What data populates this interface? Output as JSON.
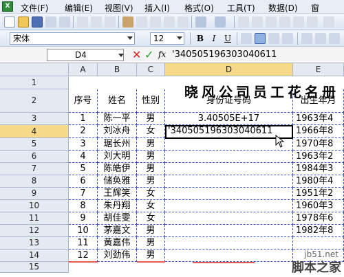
{
  "menu": [
    "文件(F)",
    "编辑(E)",
    "视图(V)",
    "插入(I)",
    "格式(O)",
    "工具(T)",
    "数据(D)",
    "窗"
  ],
  "toolbar": {
    "font": "宋体",
    "size": "12"
  },
  "formula_bar": {
    "name_box": "D4",
    "formula": "'340505196303040611",
    "fx": "fx"
  },
  "columns": [
    "A",
    "B",
    "C",
    "D",
    "E"
  ],
  "rows": [
    "1",
    "2",
    "3",
    "4",
    "5",
    "6",
    "7",
    "8",
    "9",
    "10",
    "11",
    "12",
    "13",
    "14",
    "15"
  ],
  "title": "晓风公司员工花名册",
  "headers": [
    "序号",
    "姓名",
    "性别",
    "身份证号码",
    "出生年月"
  ],
  "table": [
    [
      "1",
      "陈一平",
      "男",
      "3.40505E+17",
      "1963年4"
    ],
    [
      "2",
      "刘冰舟",
      "女",
      "'340505196303040611",
      "1966年8"
    ],
    [
      "3",
      "琚长州",
      "男",
      "",
      "1970年8"
    ],
    [
      "4",
      "刘大明",
      "男",
      "",
      "1963年2"
    ],
    [
      "5",
      "陈皓伊",
      "男",
      "",
      "1984年3"
    ],
    [
      "6",
      "储奂雅",
      "男",
      "",
      "1980年4"
    ],
    [
      "7",
      "王辉笑",
      "女",
      "",
      "1951年2"
    ],
    [
      "8",
      "朱丹翔",
      "女",
      "",
      "1960年3"
    ],
    [
      "9",
      "胡佳雯",
      "女",
      "",
      "1978年6"
    ],
    [
      "10",
      "茅嘉文",
      "男",
      "",
      "1982年8"
    ],
    [
      "11",
      "黄嘉伟",
      "男",
      "",
      ""
    ],
    [
      "12",
      "刘劲伟",
      "男",
      "",
      ""
    ]
  ],
  "watermark": {
    "site": "jb51.net",
    "name": "脚本之家"
  },
  "colors": {
    "grid_dash": "#3a55c8",
    "selected_header": "#f7d98a",
    "red_underline": "#e8584f",
    "fx_red": "#d21f1f",
    "fx_green": "#1f9d2e"
  }
}
